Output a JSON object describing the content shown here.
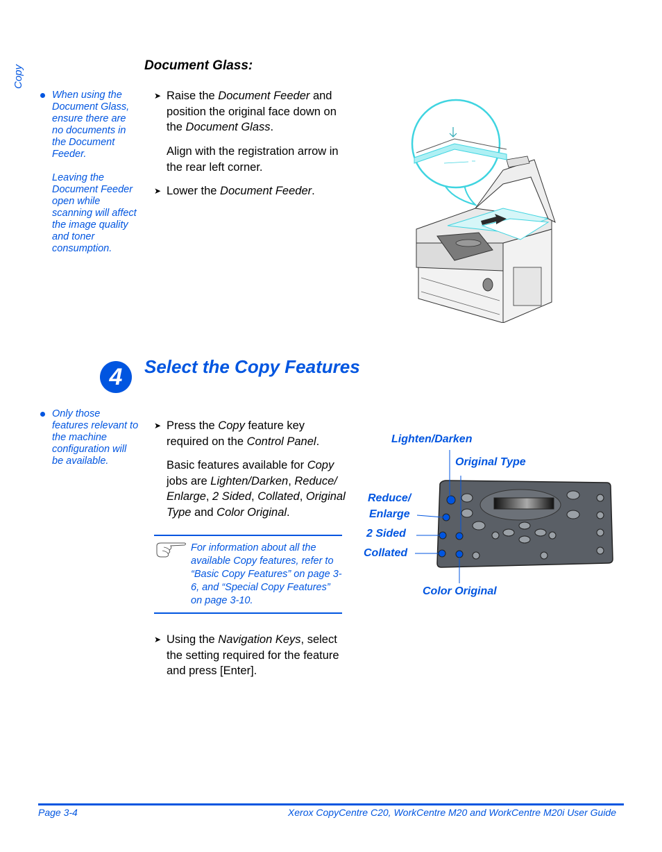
{
  "side_tab": {
    "label": "Copy"
  },
  "document_glass": {
    "heading": "Document Glass:",
    "note": {
      "paragraph_1": "When using the Document Glass, ensure there are no documents in the Document Feeder.",
      "paragraph_2": "Leaving the Document Feeder open while scanning will affect the image quality and toner consumption."
    },
    "steps": [
      {
        "pre": "Raise the ",
        "em1": "Document Feeder",
        "mid": " and position the original face down on the ",
        "em2": "Document Glass",
        "post": "."
      },
      {
        "text": "Align with the registration arrow in the rear left corner."
      },
      {
        "pre": "Lower the ",
        "em1": "Document Feeder",
        "post": "."
      }
    ],
    "illustration": "copier-with-open-document-feeder"
  },
  "section": {
    "number": "4",
    "title": "Select the Copy Features",
    "note": "Only those features relevant to the machine configuration will be available.",
    "step_1": {
      "pre": "Press the ",
      "em1": "Copy",
      "mid": " feature key required on the ",
      "em2": "Control Panel",
      "post": "."
    },
    "basic_features": {
      "t1": "Basic features available for ",
      "e1": "Copy",
      "t2": " jobs are ",
      "e2": "Lighten/Darken",
      "t3": ", ",
      "e3": "Reduce/ Enlarge",
      "t4": ", ",
      "e4": "2 Sided",
      "t5": ", ",
      "e5": "Collated",
      "t6": ", ",
      "e6": "Original Type",
      "t7": " and ",
      "e7": "Color Original",
      "t8": "."
    },
    "tip": "For information about all the available Copy features, refer to “Basic Copy Features” on page 3-6, and “Special Copy Features” on page 3-10.",
    "step_2": {
      "pre": "Using the ",
      "em1": "Navigation Keys",
      "post": ", select the setting required for the feature and press [Enter]."
    },
    "panel_callouts": {
      "lighten_darken": "Lighten/Darken",
      "original_type": "Original Type",
      "reduce_enlarge_1": "Reduce/",
      "reduce_enlarge_2": "Enlarge",
      "two_sided": "2 Sided",
      "collated": "Collated",
      "color_original": "Color Original"
    }
  },
  "footer": {
    "page": "Page 3-4",
    "guide": "Xerox CopyCentre C20, WorkCentre M20 and WorkCentre M20i User Guide"
  },
  "colors": {
    "accent": "#0055e0",
    "panel": "#5a5f66",
    "cyan": "#3fd4e0"
  }
}
